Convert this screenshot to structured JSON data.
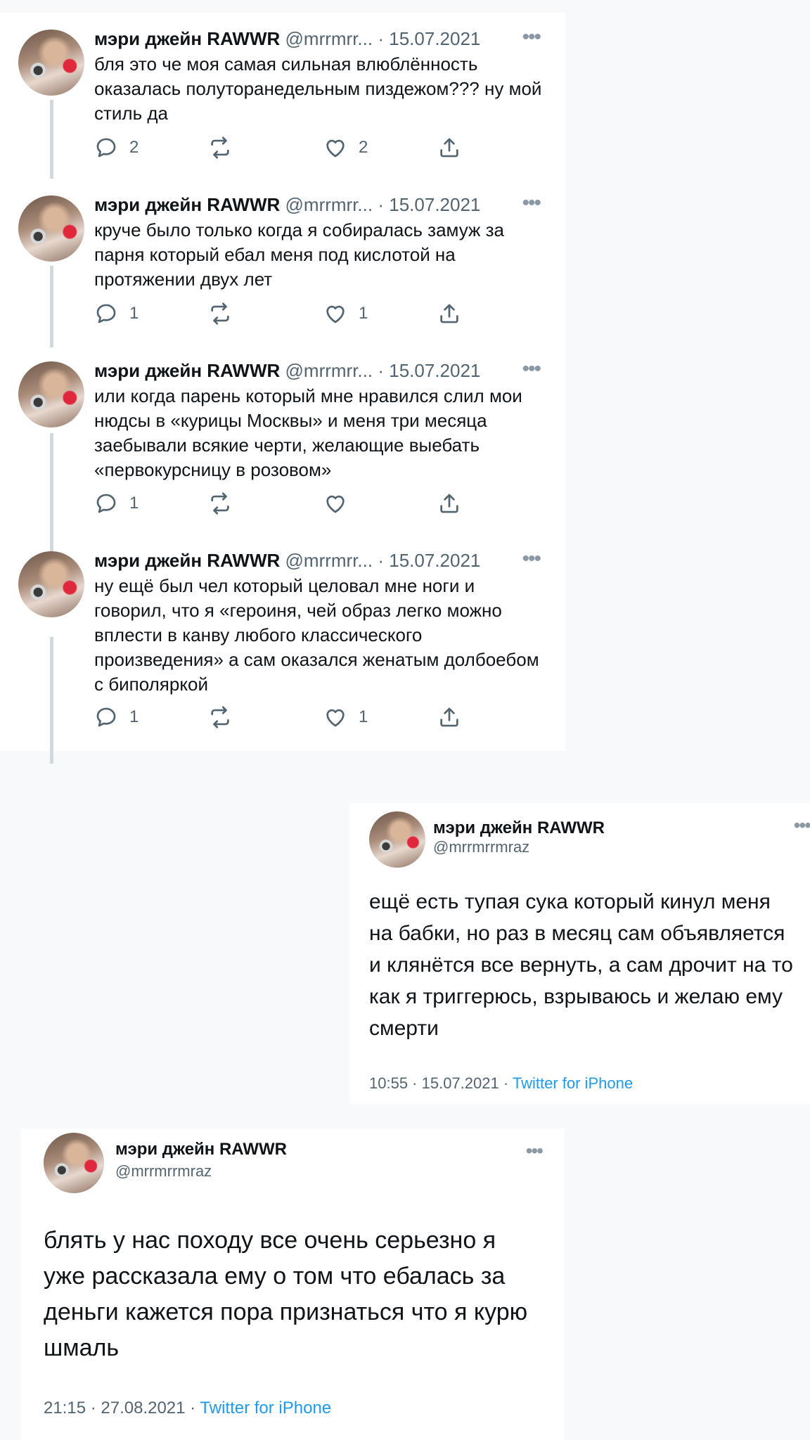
{
  "thread": {
    "tweets": [
      {
        "name": "мэри джейн RAWWR",
        "handle": "@mrrmrr...",
        "sep": "·",
        "date": "15.07.2021",
        "text": "бля это че моя самая сильная влюблённость оказалась полуторанедельным пиздежом??? ну мой стиль да",
        "replies": "2",
        "retweets": "",
        "likes": "2"
      },
      {
        "name": "мэри джейн RAWWR",
        "handle": "@mrrmrr...",
        "sep": "·",
        "date": "15.07.2021",
        "text": "круче было только когда я собиралась замуж за парня который ебал меня под кислотой на протяжении двух лет",
        "replies": "1",
        "retweets": "",
        "likes": "1"
      },
      {
        "name": "мэри джейн RAWWR",
        "handle": "@mrrmrr...",
        "sep": "·",
        "date": "15.07.2021",
        "text": "или когда парень который мне нравился слил мои нюдсы в «курицы Москвы» и меня три месяца заебывали всякие черти, желающие выебать «первокурсницу в розовом»",
        "replies": "1",
        "retweets": "",
        "likes": ""
      },
      {
        "name": "мэри джейн RAWWR",
        "handle": "@mrrmrr...",
        "sep": "·",
        "date": "15.07.2021",
        "text": "ну ещё был чел который целовал мне ноги и говорил, что я «героиня, чей образ легко можно вплести в канву любого классического произведения» а сам оказался женатым долбоебом с биполяркой",
        "replies": "1",
        "retweets": "",
        "likes": "1"
      }
    ]
  },
  "tweet_card_1": {
    "name": "мэри джейн RAWWR",
    "handle": "@mrrmrrmraz",
    "text": "ещё есть тупая сука который кинул меня на бабки, но раз в месяц сам объявляется и клянётся все вернуть, а сам дрочит на то как я триггерюсь, взрываюсь и желаю ему смерти",
    "time": "10:55 · 15.07.2021 · ",
    "source": "Twitter for iPhone"
  },
  "tweet_card_2": {
    "name": "мэри джейн RAWWR",
    "handle": "@mrrmrrmraz",
    "text": "блять у нас походу все очень серьезно я уже рассказала ему о том что ебалась за деньги кажется пора признаться что я курю шмаль",
    "time": "21:15 · 27.08.2021 · ",
    "source": "Twitter for iPhone"
  },
  "icons": {
    "more": "more-dots-icon",
    "reply": "reply-bubble-icon",
    "retweet": "retweet-arrows-icon",
    "like": "heart-icon",
    "share": "share-upload-icon"
  },
  "colors": {
    "accent": "#1d9bf0",
    "text": "#0f1419",
    "muted": "#536471",
    "thread_line": "#cfd9de"
  }
}
